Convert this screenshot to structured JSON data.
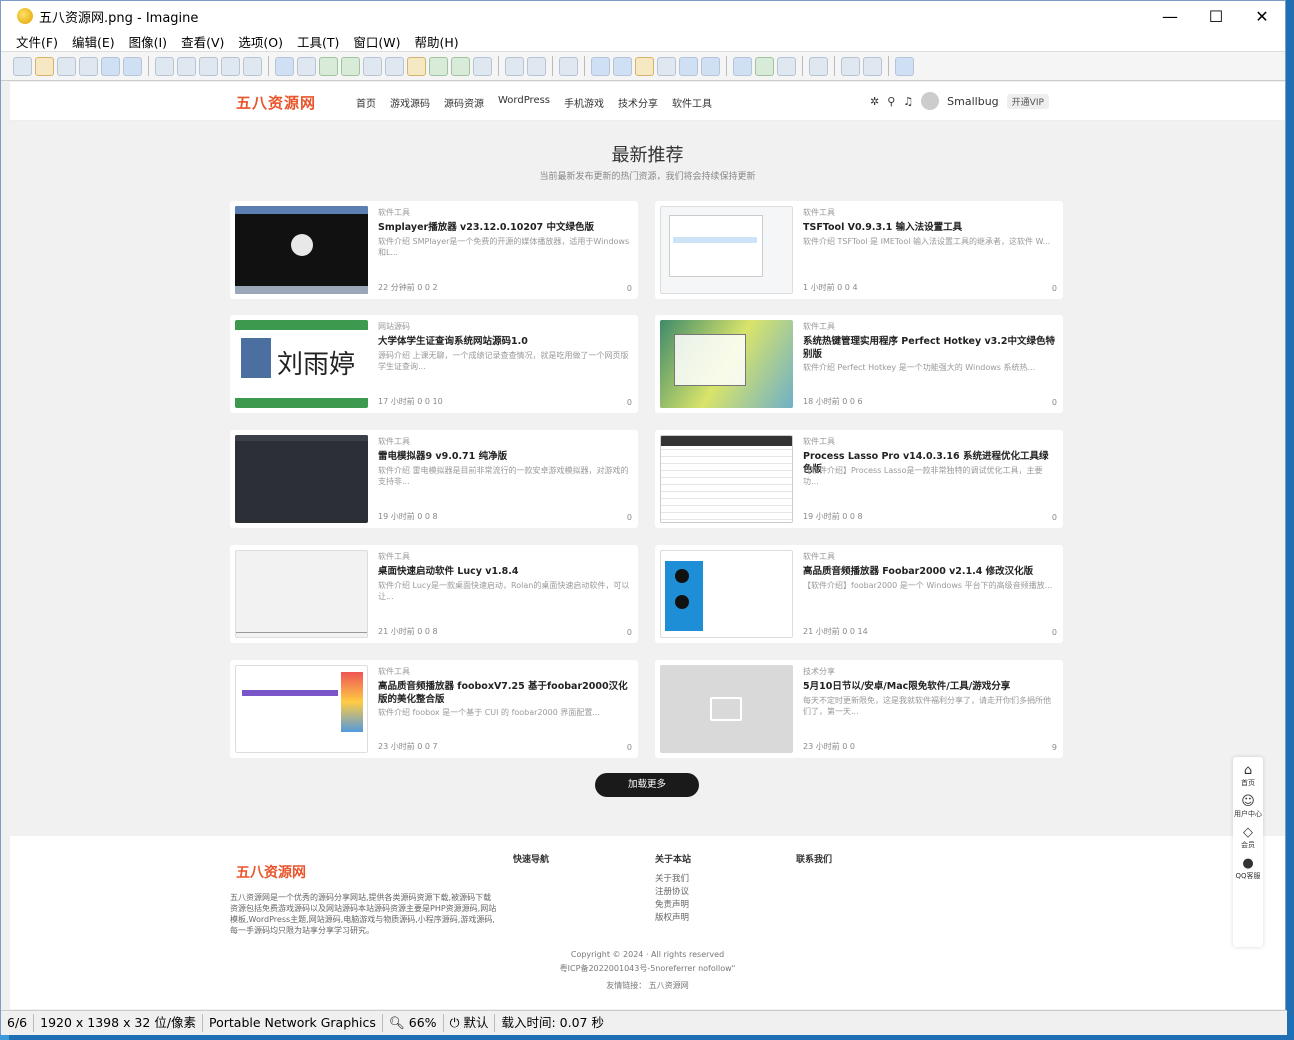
{
  "window": {
    "title": "五八资源网.png - Imagine"
  },
  "menu": [
    "文件(F)",
    "编辑(E)",
    "图像(I)",
    "查看(V)",
    "选项(O)",
    "工具(T)",
    "窗口(W)",
    "帮助(H)"
  ],
  "site": {
    "logo": "五八资源网",
    "nav": [
      "首页",
      "游戏源码",
      "源码资源",
      "WordPress",
      "手机游戏",
      "技术分享",
      "软件工具"
    ],
    "user": "Smallbug",
    "vip": "开通VIP"
  },
  "section": {
    "title": "最新推荐",
    "subtitle": "当前最新发布更新的热门资源，我们将会持续保持更新"
  },
  "cards": [
    {
      "cat": "软件工具",
      "title": "Smplayer播放器 v23.12.0.10207 中文绿色版",
      "desc": "软件介绍 SMPlayer是一个免费的开源的媒体播放器，适用于Windows和L...",
      "meta": "22 分钟前   0   0   2",
      "comments": "0"
    },
    {
      "cat": "软件工具",
      "title": "TSFTool V0.9.3.1 输入法设置工具",
      "desc": "软件介绍 TSFTool 是 IMETool 输入法设置工具的继承者，这软件 W...",
      "meta": "1 小时前   0   0   4",
      "comments": "0"
    },
    {
      "cat": "网站源码",
      "title": "大学体学生证查询系统网站源码1.0",
      "desc": "源码介绍 上课无聊，一个成绩记录查查情况，就是吃用做了一个网页版学生证查询...",
      "meta": "17 小时前   0   0   10",
      "comments": "0"
    },
    {
      "cat": "软件工具",
      "title": "系统热键管理实用程序 Perfect Hotkey v3.2中文绿色特别版",
      "desc": "软件介绍 Perfect Hotkey 是一个功能强大的 Windows 系统热...",
      "meta": "18 小时前   0   0   6",
      "comments": "0"
    },
    {
      "cat": "软件工具",
      "title": "雷电模拟器9 v9.0.71 纯净版",
      "desc": "软件介绍 雷电模拟器是目前非常流行的一款安卓游戏模拟器，对游戏的支持非...",
      "meta": "19 小时前   0   0   8",
      "comments": "0"
    },
    {
      "cat": "软件工具",
      "title": "Process Lasso Pro v14.0.3.16 系统进程优化工具绿色版",
      "desc": "【软件介绍】Process Lasso是一款非常独特的调试优化工具，主要功...",
      "meta": "19 小时前   0   0   8",
      "comments": "0"
    },
    {
      "cat": "软件工具",
      "title": "桌面快速启动软件 Lucy v1.8.4",
      "desc": "软件介绍 Lucy是一款桌面快速启动，Rolan的桌面快速启动软件，可以让...",
      "meta": "21 小时前   0   0   8",
      "comments": "0"
    },
    {
      "cat": "软件工具",
      "title": "高品质音频播放器 Foobar2000 v2.1.4 修改汉化版",
      "desc": "【软件介绍】foobar2000 是一个 Windows 平台下的高级音频播放...",
      "meta": "21 小时前   0   0   14",
      "comments": "0"
    },
    {
      "cat": "软件工具",
      "title": "高品质音频播放器 fooboxV7.25 基于foobar2000汉化版的美化整合版",
      "desc": "软件介绍 foobox 是一个基于 CUI 的 foobar2000 界面配置...",
      "meta": "23 小时前   0   0   7",
      "comments": "0"
    },
    {
      "cat": "技术分享",
      "title": "5月10日节以/安卓/Mac限免软件/工具/游戏分享",
      "desc": "每天不定时更新限免，这是我就软件福利分享了，请走开你们多捐所他们了，第一天...",
      "meta": "23 小时前   0   0",
      "comments": "9"
    }
  ],
  "load_more": "加载更多",
  "footer": {
    "logo": "五八资源网",
    "desc": "五八资源网是一个优秀的源码分享网站,提供各类源码资源下载,被源码下载资源包括免费游戏源码以及网站源码本站源码资源主要是PHP资源源码,网站模板,WordPress主题,网站源码,电脑游戏与物质源码,小程序源码,游戏源码,每一手源码均只限为站享分享学习研究。",
    "quick_nav": "快速导航",
    "about": {
      "h": "关于本站",
      "items": [
        "关于我们",
        "注册协议",
        "免责声明",
        "版权声明"
      ]
    },
    "contact": "联系我们",
    "copyright": "Copyright © 2024 · All rights reserved",
    "icp": "粤ICP备2022001043号-5noreferrer nofollow\"",
    "links": "友情链接：  五八资源网"
  },
  "side_float": [
    "首页",
    "用户中心",
    "会员",
    "QQ客服"
  ],
  "status": {
    "page": "6/6",
    "dims": "1920 x 1398 x 32 位/像素",
    "format": "Portable Network Graphics",
    "zoom": "66%",
    "mode": "默认",
    "load": "载入时间: 0.07 秒"
  }
}
